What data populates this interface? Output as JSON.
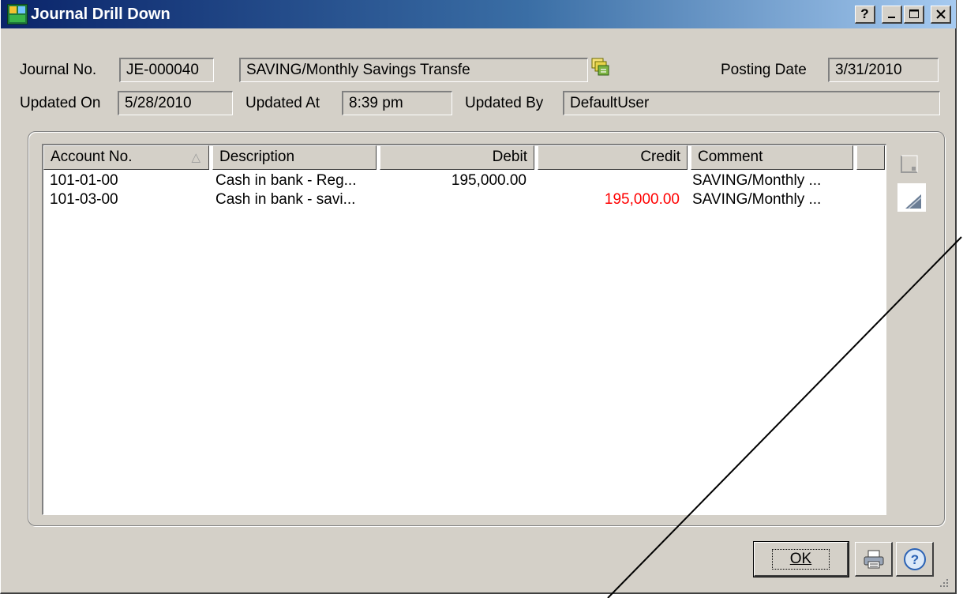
{
  "window": {
    "title": "Journal Drill Down",
    "app_icon": "sage-mas90-icon"
  },
  "titlebar_buttons": {
    "help": "?",
    "minimize": "_",
    "maximize": "□",
    "close": "×"
  },
  "header": {
    "journal_no_label": "Journal No.",
    "journal_no_value": "JE-000040",
    "journal_desc_value": "SAVING/Monthly Savings Transfe",
    "posting_date_label": "Posting Date",
    "posting_date_value": "3/31/2010",
    "updated_on_label": "Updated On",
    "updated_on_value": "5/28/2010",
    "updated_at_label": "Updated At",
    "updated_at_value": "8:39 pm",
    "updated_by_label": "Updated By",
    "updated_by_value": "DefaultUser"
  },
  "grid": {
    "columns": {
      "account": "Account No.",
      "description": "Description",
      "debit": "Debit",
      "credit": "Credit",
      "comment": "Comment"
    },
    "sort_indicator": "△",
    "rows": [
      {
        "account": "101-01-00",
        "description": "Cash in bank - Reg...",
        "debit": "195,000.00",
        "credit": "",
        "comment": "SAVING/Monthly ..."
      },
      {
        "account": "101-03-00",
        "description": "Cash in bank - savi...",
        "debit": "",
        "credit": "195,000.00",
        "comment": "SAVING/Monthly ..."
      }
    ]
  },
  "buttons": {
    "ok": "OK",
    "print": "print-icon",
    "help": "?"
  },
  "colors": {
    "credit_text": "#ff0000",
    "title_start": "#0a246a",
    "title_end": "#a6caf0",
    "face": "#d4d0c8"
  }
}
